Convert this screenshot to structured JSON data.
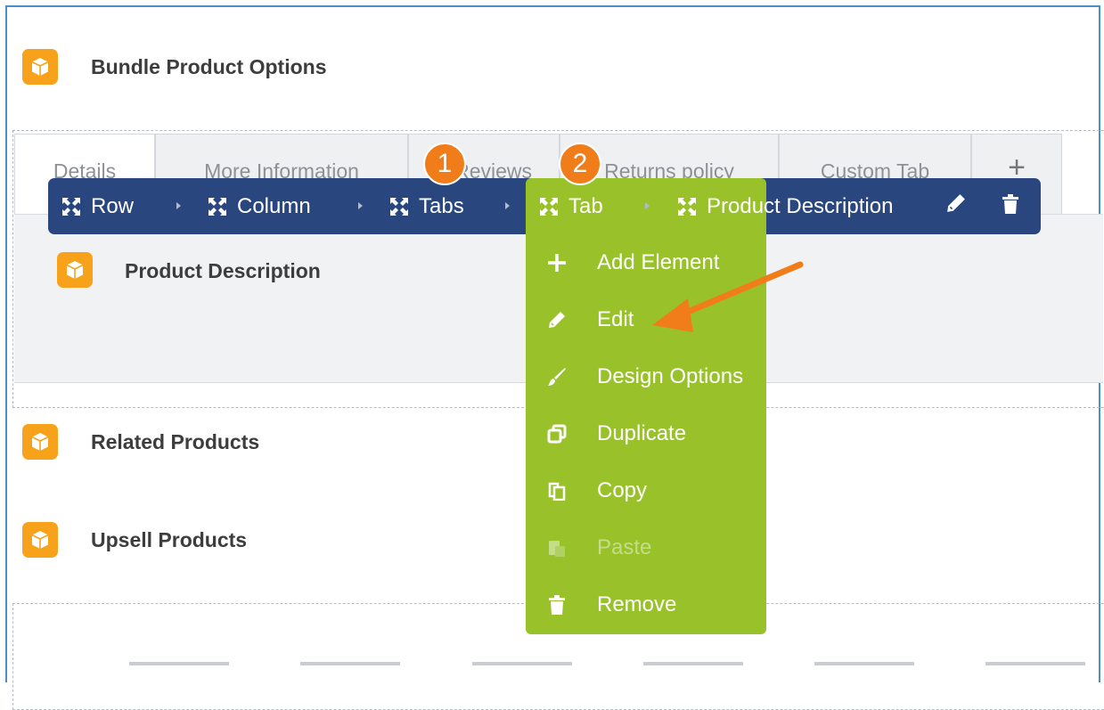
{
  "blocks": {
    "bundle": "Bundle Product Options",
    "product_description": "Product Description",
    "related": "Related Products",
    "upsell": "Upsell Products"
  },
  "tabs": [
    {
      "label": "Details"
    },
    {
      "label": "More Information"
    },
    {
      "label": "Reviews"
    },
    {
      "label": "Returns policy"
    },
    {
      "label": "Custom Tab"
    },
    {
      "label": "+"
    }
  ],
  "breadcrumb": [
    {
      "label": "Row"
    },
    {
      "label": "Column"
    },
    {
      "label": "Tabs"
    },
    {
      "label": "Tab"
    },
    {
      "label": "Product Description"
    }
  ],
  "context_menu": [
    {
      "label": "Add Element",
      "icon": "plus-icon",
      "enabled": true
    },
    {
      "label": "Edit",
      "icon": "pencil-icon",
      "enabled": true
    },
    {
      "label": "Design Options",
      "icon": "brush-icon",
      "enabled": true
    },
    {
      "label": "Duplicate",
      "icon": "duplicate-icon",
      "enabled": true
    },
    {
      "label": "Copy",
      "icon": "copy-icon",
      "enabled": true
    },
    {
      "label": "Paste",
      "icon": "paste-icon",
      "enabled": false
    },
    {
      "label": "Remove",
      "icon": "trash-icon",
      "enabled": true
    }
  ],
  "annotations": {
    "badge1": "1",
    "badge2": "2"
  },
  "colors": {
    "breadcrumb_bg": "#29477e",
    "menu_bg": "#99c22a",
    "block_icon": "#f7a21a",
    "badge": "#f07d19",
    "frame_border": "#4a8fc7"
  }
}
